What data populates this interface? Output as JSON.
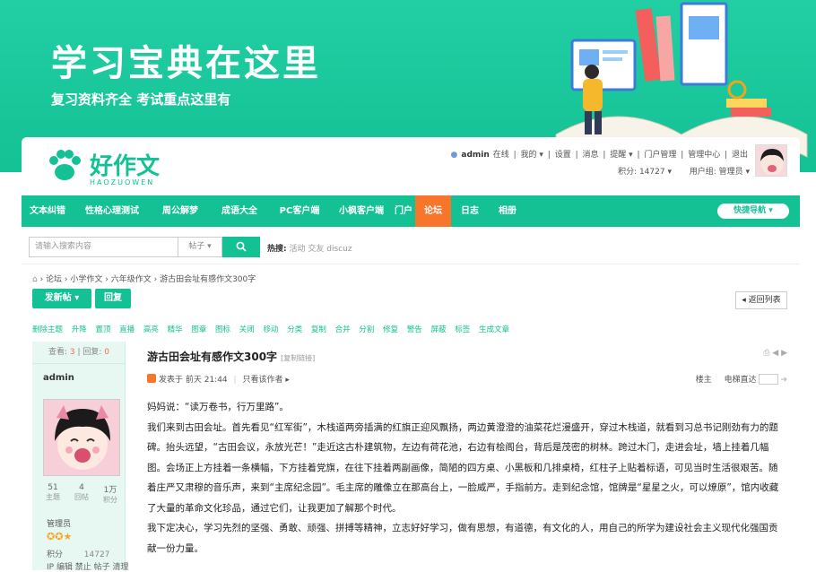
{
  "banner": {
    "title": "学习宝典在这里",
    "subtitle": "复习资料齐全 考试重点这里有"
  },
  "logo": {
    "text": "好作文",
    "en": "HAOZUOWEN"
  },
  "userbar": {
    "items": [
      "admin",
      "在线",
      "我的 ▾",
      "设置",
      "消息",
      "提醒 ▾",
      "门户管理",
      "管理中心",
      "退出"
    ],
    "score": "积分: 14727 ▾",
    "group": "用户组: 管理员 ▾"
  },
  "nav": {
    "items": [
      "文本纠错",
      "性格心理测试",
      "周公解梦",
      "成语大全",
      "PC客户端",
      "小枫客户端",
      "门户",
      "论坛",
      "日志",
      "相册"
    ],
    "active_index": 7,
    "quick_nav": "快捷导航 ▾"
  },
  "search": {
    "placeholder": "请输入搜索内容",
    "type": "帖子 ▾",
    "hot_label": "热搜:",
    "hot_items": [
      "活动",
      "交友",
      "discuz"
    ]
  },
  "breadcrumb": [
    "论坛",
    "小学作文",
    "六年级作文",
    "游古田会址有感作文300字"
  ],
  "buttons": {
    "new_post": "发新帖 ▾",
    "reply": "回复",
    "back": "◂ 返回列表"
  },
  "mod_actions": [
    "删除主题",
    "升降",
    "置顶",
    "直播",
    "高亮",
    "精华",
    "图章",
    "图标",
    "关闭",
    "移动",
    "分类",
    "复制",
    "合并",
    "分割",
    "修复",
    "警告",
    "屏蔽",
    "标签",
    "生成文章"
  ],
  "thread": {
    "views_label": "查看:",
    "views": "3",
    "replies_label": "回复:",
    "replies": "0",
    "title": "游古田会址有感作文300字",
    "copy_link": "[复制链接]",
    "author": "admin",
    "post_time": "发表于 前天 21:44",
    "only_author": "只看该作者 ▸",
    "floor": "楼主",
    "jump": "电梯直达",
    "paragraphs": [
      "妈妈说：“读万卷书，行万里路”。",
      "我们来到古田会址。首先看见“红军街”，木栈道两旁插满的红旗正迎风飘扬，两边黄澄澄的油菜花烂漫盛开，穿过木栈道，就看到习总书记刚劲有力的题碑。抬头远望，“古田会议，永放光芒！”走近这古朴建筑物，左边有荷花池，右边有桧阁台，背后是茂密的树林。跨过木门，走进会址，墙上挂着几幅图。会场正上方挂着一条横幅，下方挂着党旗，在往下挂着两副画像，简陋的四方桌、小黑板和几排桌椅，红柱子上贴着标语，可见当时生活很艰苦。随着庄严又肃穆的音乐声，来到“主席纪念园”。毛主席的雕像立在那高台上，一脸威严，手指前方。走到纪念馆，馆牌是“星星之火，可以燎原”，馆内收藏了大量的革命文化珍品，通过它们，让我更加了解那个时代。",
      "我下定决心，学习先烈的坚强、勇敢、顽强、拼搏等精神，立志好好学习，做有思想，有道德，有文化的人，用自己的所学为建设社会主义现代化强国贡献一份力量。"
    ]
  },
  "user": {
    "stats": [
      {
        "value": "51",
        "label": "主题"
      },
      {
        "value": "4",
        "label": "回帖"
      },
      {
        "value": "1万",
        "label": "积分"
      }
    ],
    "role": "管理员",
    "score_label": "积分",
    "score": "14727",
    "extra": "IP 编辑 禁止 帖子 清理"
  }
}
